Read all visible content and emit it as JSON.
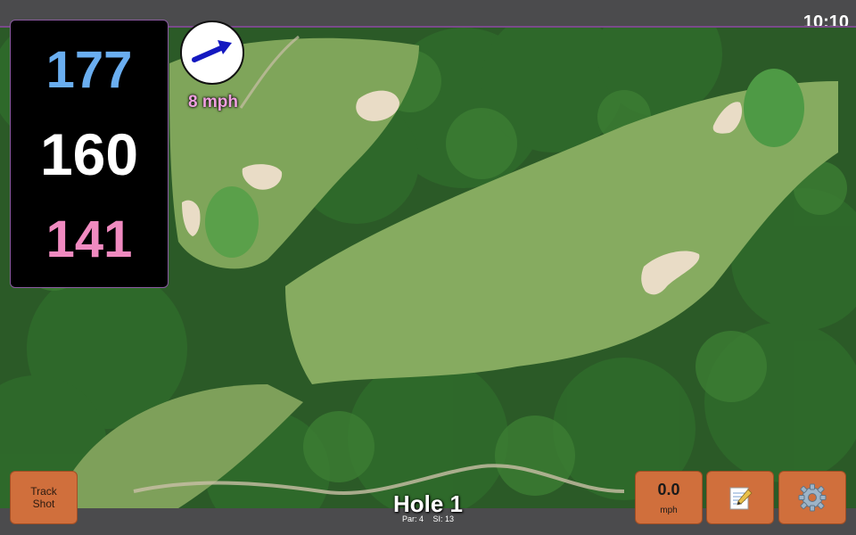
{
  "status_bar": {
    "time": "10:10"
  },
  "yardages": {
    "back": "177",
    "middle": "160",
    "front": "141"
  },
  "wind": {
    "speed": "8 mph",
    "direction_icon": "wind-arrow-icon"
  },
  "hole": {
    "title": "Hole 1",
    "par": "Par: 4",
    "stroke_index": "SI: 13"
  },
  "buttons": {
    "track_shot": "Track Shot",
    "speed_value": "0.0",
    "speed_unit": "mph",
    "notes_icon": "notepad-icon",
    "settings_icon": "gear-icon"
  },
  "colors": {
    "back_yardage": "#6aaef0",
    "middle_yardage": "#ffffff",
    "front_yardage": "#f08ac0",
    "button_bg": "#d06f3c",
    "wind_text": "#f0a0e0"
  }
}
